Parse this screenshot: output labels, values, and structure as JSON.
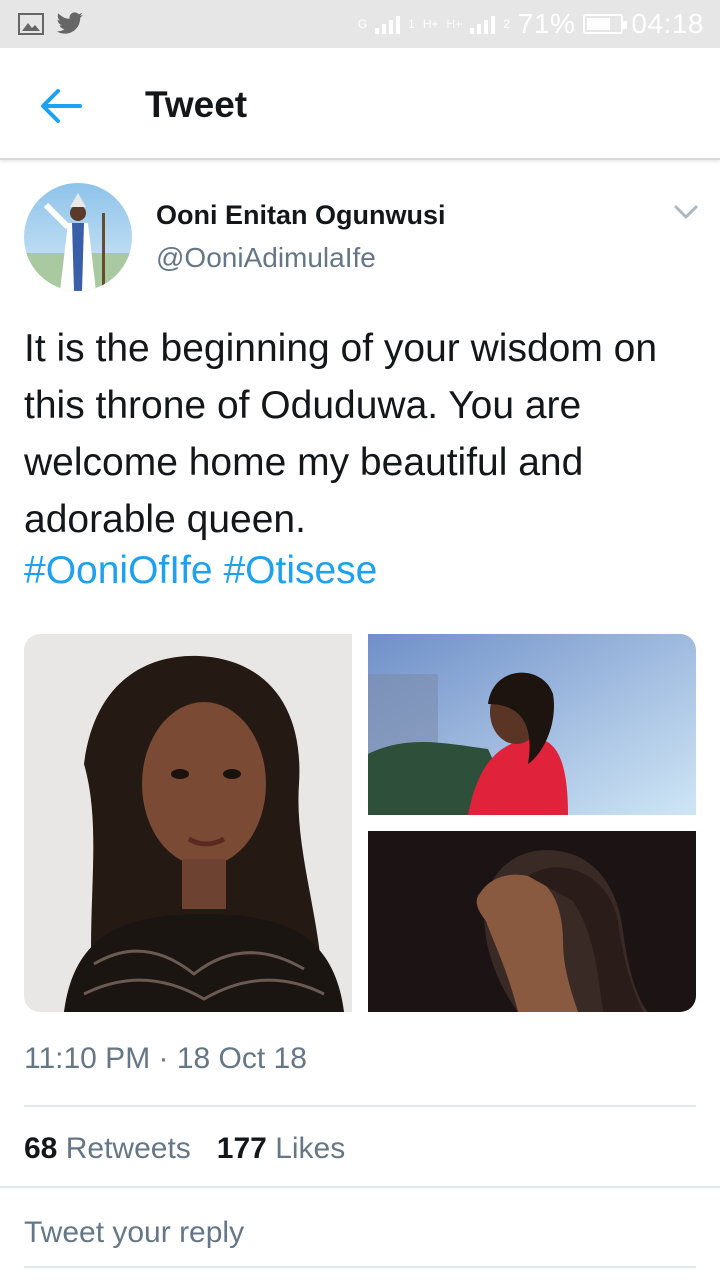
{
  "status_bar": {
    "network_g": "G",
    "network_h1": "H+",
    "network_h2": "H+",
    "sim1": "1",
    "sim2": "2",
    "battery": "71%",
    "battery_level": 0.71,
    "time": "04:18",
    "icons": [
      "image-icon",
      "twitter-bird-icon"
    ]
  },
  "header": {
    "title": "Tweet",
    "back_icon": "arrow-left-icon",
    "accent": "#1da1f2"
  },
  "tweet": {
    "author_name": "Ooni Enitan Ogunwusi",
    "author_handle": "@OoniAdimulaIfe",
    "menu_icon": "chevron-down-icon",
    "text": "It is the beginning of your wisdom on this throne of Oduduwa. You are welcome home my beautiful and adorable queen.",
    "hashtags": [
      "#OoniOfIfe",
      "#Otisese"
    ],
    "media_count": 3,
    "timestamp": "11:10 PM · 18 Oct 18",
    "retweets_count": "68",
    "retweets_label": "Retweets",
    "likes_count": "177",
    "likes_label": "Likes"
  },
  "reply": {
    "placeholder": "Tweet your reply"
  }
}
